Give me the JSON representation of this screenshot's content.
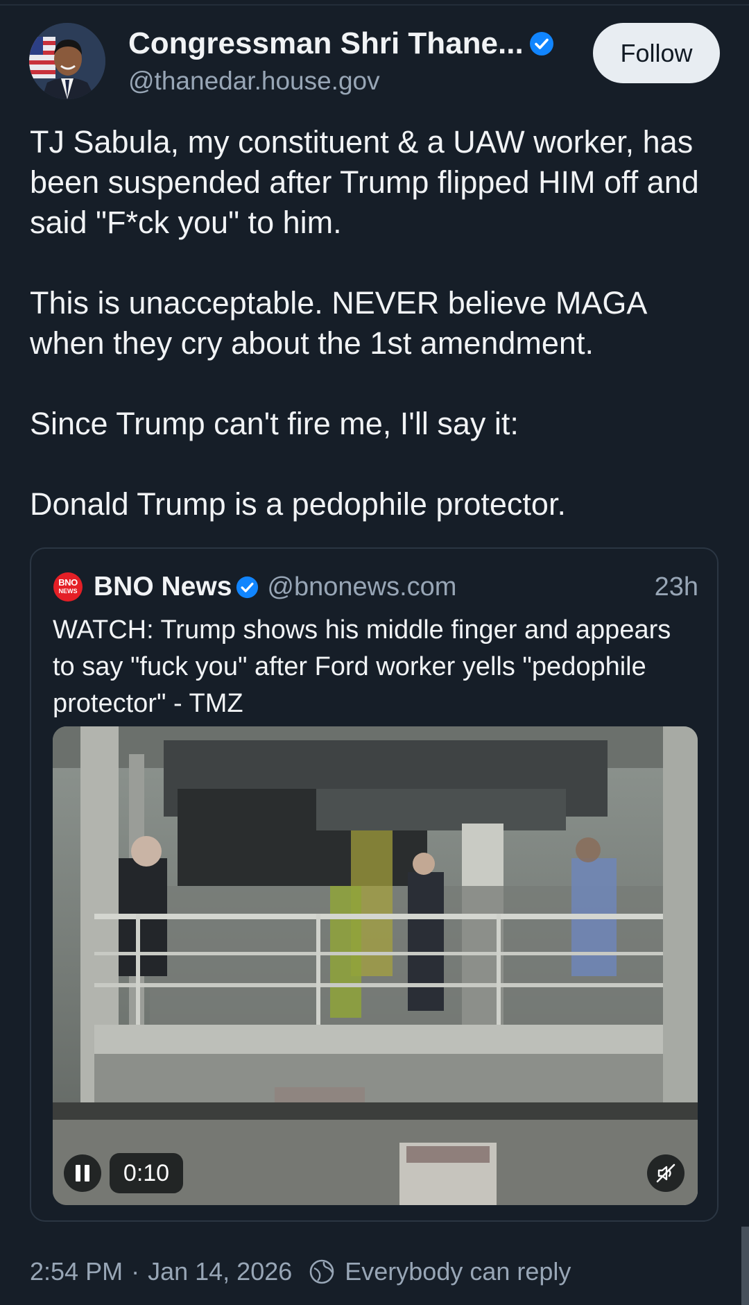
{
  "post": {
    "author": {
      "display_name": "Congressman Shri Thane...",
      "handle": "@thanedar.house.gov",
      "verified": true,
      "avatar_icon": "avatar-portrait"
    },
    "follow_label": "Follow",
    "paragraphs": [
      "TJ Sabula, my constituent & a UAW worker, has been suspended after Trump flipped HIM off and said \"F*ck you\" to him.",
      "This is unacceptable. NEVER believe MAGA when they cry about the 1st amendment.",
      "Since Trump can't fire me, I'll say it:",
      "Donald Trump is a pedophile protector."
    ],
    "timestamp": "2:54 PM",
    "date": "Jan 14, 2026",
    "separator": "·",
    "reply_setting": "Everybody can reply"
  },
  "quote": {
    "logo_text_top": "BNO",
    "logo_text_bottom": "NEWS",
    "display_name": "BNO News",
    "verified": true,
    "handle": "@bnonews.com",
    "time": "23h",
    "text": "WATCH: Trump shows his middle finger and appears to say \"fuck you\" after Ford worker yells \"pedophile protector\" - TMZ",
    "video": {
      "elapsed": "0:10",
      "state": "playing",
      "muted": true
    }
  },
  "colors": {
    "background": "#161e28",
    "text": "#f1f3f5",
    "muted_text": "#98a6b6",
    "verified_blue": "#1185fe",
    "follow_bg": "#e8edf2",
    "bno_red": "#e41f26"
  }
}
